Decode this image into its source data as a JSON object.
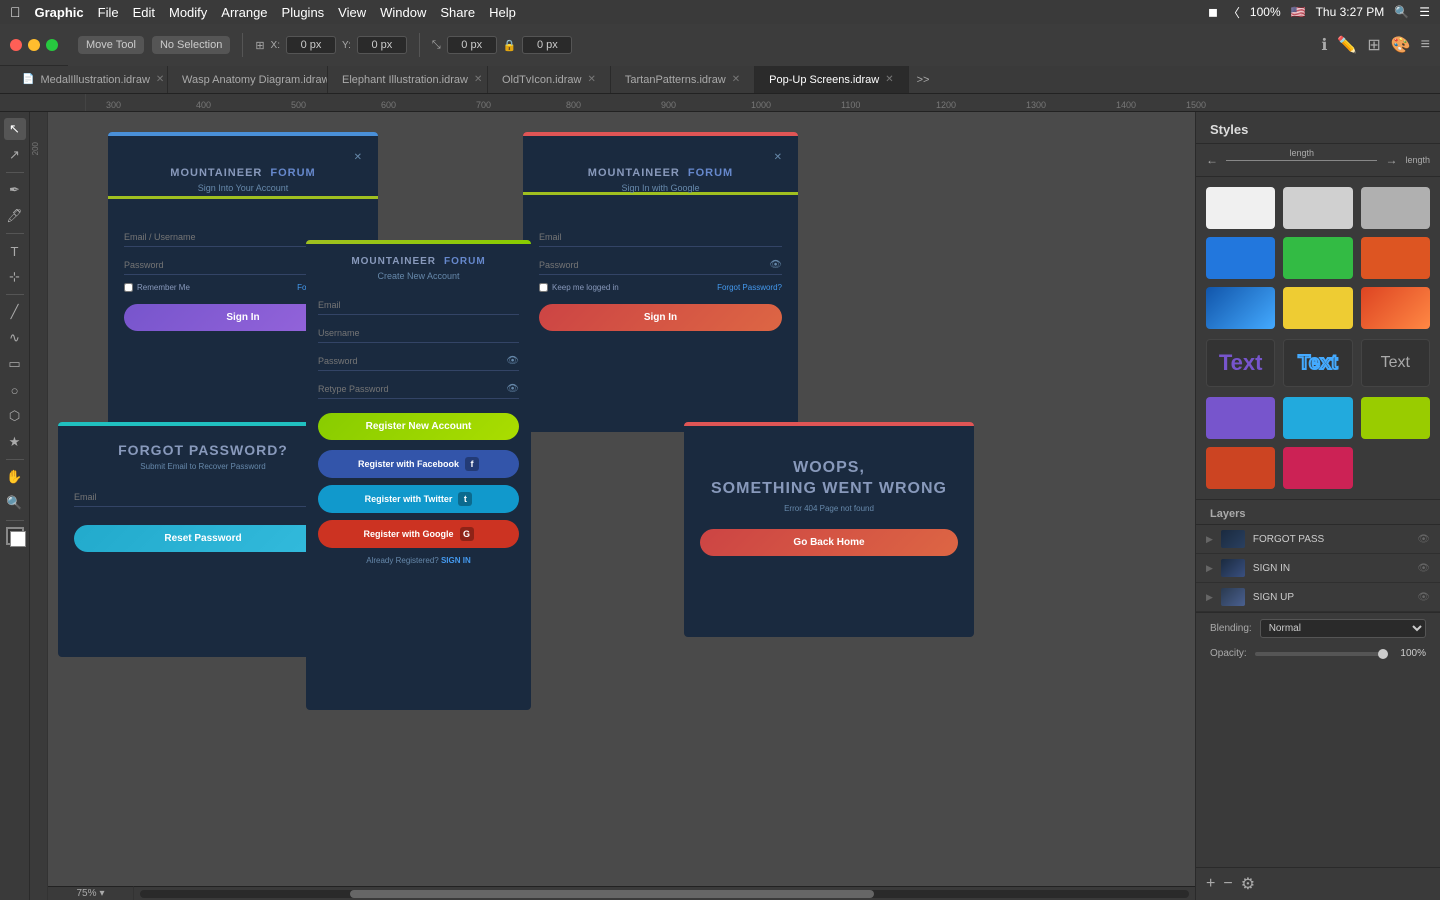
{
  "app": {
    "title": "Pop-Up Screens.idraw",
    "zoom": "75%"
  },
  "menubar": {
    "apple": "⌘",
    "items": [
      "Graphic",
      "File",
      "Edit",
      "Modify",
      "Arrange",
      "Plugins",
      "View",
      "Window",
      "Share",
      "Help"
    ],
    "right": [
      "Thu 3:27 PM",
      "100%"
    ]
  },
  "toolbar": {
    "tool": "Move Tool",
    "selection": "No Selection",
    "x_label": "X:",
    "x_val": "0 px",
    "y_label": "Y:",
    "y_val": "0 px",
    "w_val": "0 px",
    "h_val": "0 px"
  },
  "tabs": [
    {
      "label": "MedalIllustration.idraw",
      "active": false
    },
    {
      "label": "Wasp Anatomy Diagram.idraw",
      "active": false
    },
    {
      "label": "Elephant Illustration.idraw",
      "active": false
    },
    {
      "label": "OldTvIcon.idraw",
      "active": false
    },
    {
      "label": "TartanPatterns.idraw",
      "active": false
    },
    {
      "label": "Pop-Up Screens.idraw",
      "active": true
    }
  ],
  "ruler": {
    "marks": [
      "300",
      "400",
      "500",
      "600",
      "700",
      "800",
      "900",
      "1000",
      "1100",
      "1200",
      "1300",
      "1400",
      "1500"
    ]
  },
  "screens": {
    "signin": {
      "brand_left": "MOUNTAINEER",
      "brand_right": "FORUM",
      "subtitle": "Sign Into Your Account",
      "email_placeholder": "Email / Username",
      "password_placeholder": "Password",
      "remember_label": "Remember Me",
      "forgot_label": "Forgot Password?",
      "btn_label": "Sign In"
    },
    "signin_google": {
      "brand_left": "MOUNTAINEER",
      "brand_right": "FORUM",
      "subtitle": "Sign In with Google",
      "email_placeholder": "Email",
      "password_placeholder": "Password",
      "remember_label": "Keep me logged in",
      "forgot_label": "Forgot Password?",
      "btn_label": "Sign In"
    },
    "create": {
      "brand_left": "MOUNTAINEER",
      "brand_right": "FORUM",
      "subtitle": "Create New Account",
      "email_placeholder": "Email",
      "username_placeholder": "Username",
      "password_placeholder": "Password",
      "retype_placeholder": "Retype Password",
      "btn_register": "Register New Account",
      "btn_facebook": "Register with Facebook",
      "btn_twitter": "Register with Twitter",
      "btn_google": "Register with Google",
      "already_text": "Already Registered?",
      "signin_link": "SIGN IN"
    },
    "forgot": {
      "title": "FORGOT PASSWORD?",
      "subtitle": "Submit Email to Recover Password",
      "email_placeholder": "Email",
      "btn_label": "Reset Password"
    },
    "error": {
      "title_line1": "WOOPS,",
      "title_line2": "SOMETHING WENT WRONG",
      "subtitle": "Error 404 Page not found",
      "btn_label": "Go Back Home"
    }
  },
  "styles_panel": {
    "title": "Styles",
    "length_label": "length"
  },
  "layers": {
    "title": "Layers",
    "items": [
      {
        "name": "FORGOT PASS",
        "visible": true
      },
      {
        "name": "SIGN IN",
        "visible": true
      },
      {
        "name": "SIGN UP",
        "visible": true
      }
    ]
  },
  "blending": {
    "label": "Blending:",
    "value": "Normal",
    "opacity_label": "Opacity:",
    "opacity_value": "100%"
  }
}
